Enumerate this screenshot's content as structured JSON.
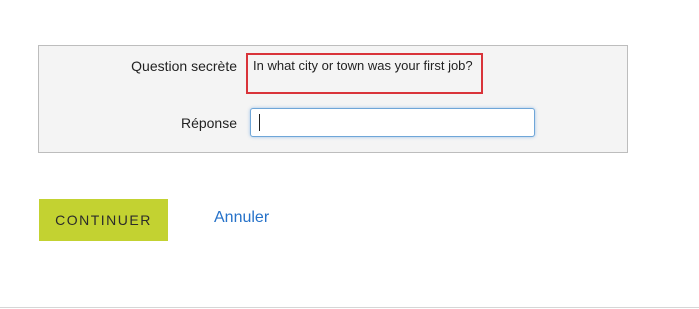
{
  "form": {
    "question_label": "Question secrète",
    "question_text": "In what city or town was your first job?",
    "answer_label": "Réponse",
    "answer_value": ""
  },
  "actions": {
    "continue_label": "CONTINUER",
    "cancel_label": "Annuler"
  },
  "colors": {
    "continue_button_bg": "#c3d231",
    "cancel_link": "#2672c9",
    "question_highlight_border": "#d9343a",
    "input_focus_border": "#6fa6d8"
  }
}
